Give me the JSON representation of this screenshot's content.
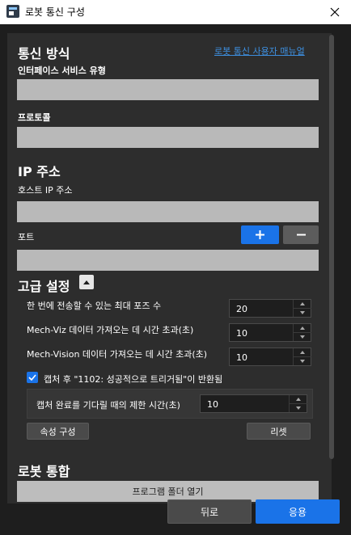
{
  "window": {
    "title": "로봇 통신 구성",
    "icon": "app-logo-icon",
    "close_icon": "close-icon"
  },
  "communication": {
    "heading": "통신 방식",
    "manual_link": "로봇 통신 사용자 매뉴얼",
    "interface_label": "인터페이스 서비스 유형",
    "protocol_label": "프로토콜"
  },
  "ip": {
    "heading": "IP 주소",
    "host_label": "호스트 IP 주소",
    "port_label": "포트",
    "add_icon": "plus-icon",
    "remove_icon": "minus-icon"
  },
  "advanced": {
    "heading": "고급 설정",
    "collapse_icon": "chevron-up-icon",
    "max_poses_label": "한 번에 전송할 수 있는 최대 포즈 수",
    "max_poses_value": "20",
    "viz_timeout_label": "Mech-Viz 데이터 가져오는 데 시간 초과(초)",
    "viz_timeout_value": "10",
    "vision_timeout_label": "Mech-Vision 데이터 가져오는 데 시간 초과(초)",
    "vision_timeout_value": "10",
    "trigger_checkbox_label": "캡처 후 \"1102: 성공적으로 트리거됨\"이 반환됨",
    "trigger_checked": true,
    "capture_wait_label": "캡처 완료를 기다릴 때의 제한 시간(초)",
    "capture_wait_value": "10",
    "property_button": "속성 구성",
    "reset_button": "리셋"
  },
  "robot_integration": {
    "heading": "로봇 통합",
    "open_folder_button": "프로그램 폴더 열기"
  },
  "footer": {
    "back_button": "뒤로",
    "apply_button": "응용"
  },
  "colors": {
    "accent": "#1a73e8",
    "link": "#3d8fe0",
    "panel": "#2d2d2d",
    "frame": "#1e1e1e"
  }
}
